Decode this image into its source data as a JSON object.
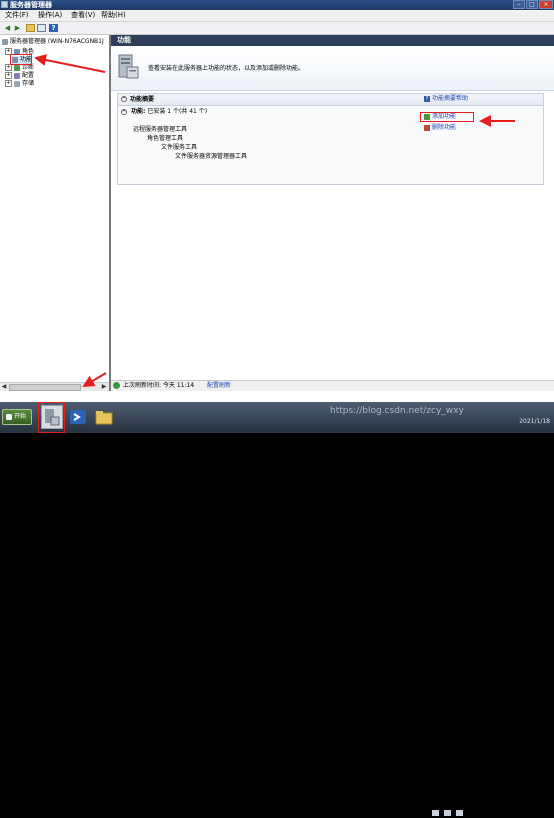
{
  "window": {
    "title": "服务器管理器"
  },
  "menu": {
    "file": "文件(F)",
    "action": "操作(A)",
    "view": "查看(V)",
    "help": "帮助(H)"
  },
  "tree": {
    "root": "服务器管理器 (WIN-N76ACGNB1J",
    "items": [
      {
        "label": "角色"
      },
      {
        "label": "功能"
      },
      {
        "label": "诊断"
      },
      {
        "label": "配置"
      },
      {
        "label": "存储"
      }
    ]
  },
  "main": {
    "header": "功能",
    "description": "查看安装在此服务器上功能的状态，以及添加或删除功能。",
    "summary": {
      "title": "功能摘要",
      "help_link": "功能摘要帮助",
      "installed_label": "功能:",
      "installed_value": "已安装 1 个(共 41 个)",
      "features": [
        "远程服务器管理工具",
        "角色管理工具",
        "文件服务工具",
        "文件服务器资源管理器工具"
      ],
      "add_link": "添加功能",
      "remove_link": "删除功能"
    }
  },
  "status": {
    "refresh_label": "上次刷新时间: 今天 11:14",
    "config_link": "配置刷新"
  },
  "taskbar": {
    "start": "开始"
  },
  "tray": {
    "date": "2021/1/18"
  },
  "watermark": "https://blog.csdn.net/zcy_wxy",
  "colors": {
    "header": "#2d3f5a",
    "link": "#1a46b8",
    "highlight": "#e51f1f"
  }
}
